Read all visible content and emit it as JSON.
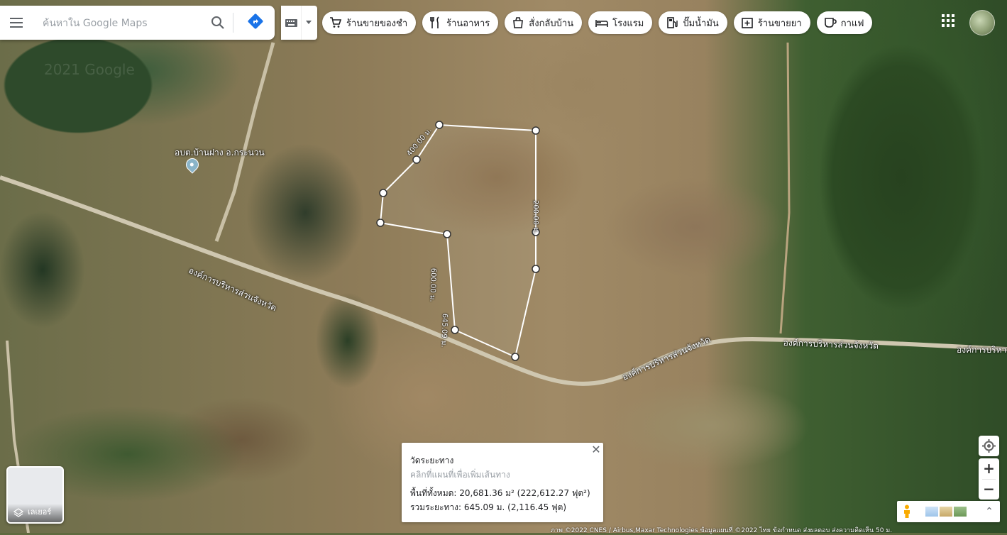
{
  "search": {
    "placeholder": "ค้นหาใน Google Maps"
  },
  "chips": [
    {
      "label": "ร้านขายของชำ",
      "icon": "cart-icon"
    },
    {
      "label": "ร้านอาหาร",
      "icon": "fork-knife-icon"
    },
    {
      "label": "สั่งกลับบ้าน",
      "icon": "takeout-icon"
    },
    {
      "label": "โรงแรม",
      "icon": "bed-icon"
    },
    {
      "label": "ปั๊มน้ำมัน",
      "icon": "gas-pump-icon"
    },
    {
      "label": "ร้านขายยา",
      "icon": "pharmacy-icon"
    },
    {
      "label": "กาแฟ",
      "icon": "coffee-icon"
    }
  ],
  "map": {
    "watermark": "2021 Google",
    "place": "อบต.บ้านฝาง อ.กระนวน",
    "roads": [
      "องค์การบริหารส่วนจังหวัด",
      "องค์การบริหารส่วนจังหวัด",
      "องค์การบริหารส่วนจังหวัด",
      "องค์การบริหาร"
    ],
    "segment_labels": [
      "400.00 ม.",
      "200.00 ม.",
      "600.00 ม.",
      "645.09 ม."
    ]
  },
  "measure": {
    "title": "วัดระยะทาง",
    "hint": "คลิกที่แผนที่เพื่อเพิ่มเส้นทาง",
    "area": "พื้นที่ทั้งหมด: 20,681.36 ม² (222,612.27 ฟุต²)",
    "distance": "รวมระยะทาง: 645.09 ม. (2,116.45 ฟุต)",
    "close": "✕"
  },
  "layers": {
    "label": "เลเยอร์"
  },
  "zoom": {
    "in": "+",
    "out": "−"
  },
  "expand": "⌃",
  "footer": "ภาพ ©2022 CNES / Airbus,Maxar Technologies ข้อมูลแผนที่ ©2022    ไทย    ข้อกำหนด    ส่งผลตอบ    ส่งความคิดเห็น    50 ม."
}
